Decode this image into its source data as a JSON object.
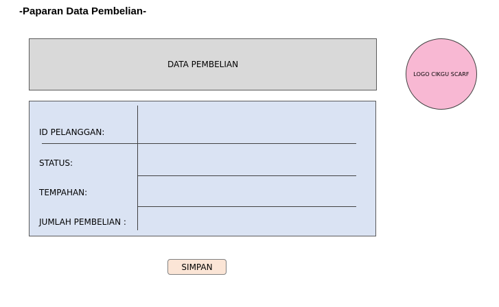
{
  "page": {
    "title": "-Paparan Data Pembelian-"
  },
  "header": {
    "label": "DATA PEMBELIAN"
  },
  "logo": {
    "label": "LOGO CIKGU SCARF",
    "color": "#f8b8d3"
  },
  "form": {
    "fields": [
      {
        "label": "ID PELANGGAN:",
        "value": ""
      },
      {
        "label": "STATUS:",
        "value": ""
      },
      {
        "label": "TEMPAHAN:",
        "value": ""
      },
      {
        "label": "JUMLAH PEMBELIAN :",
        "value": ""
      }
    ]
  },
  "actions": {
    "save_label": "SIMPAN"
  },
  "colors": {
    "header_bg": "#d9d9d9",
    "form_bg": "#dae3f3",
    "button_bg": "#fbe5d6"
  }
}
